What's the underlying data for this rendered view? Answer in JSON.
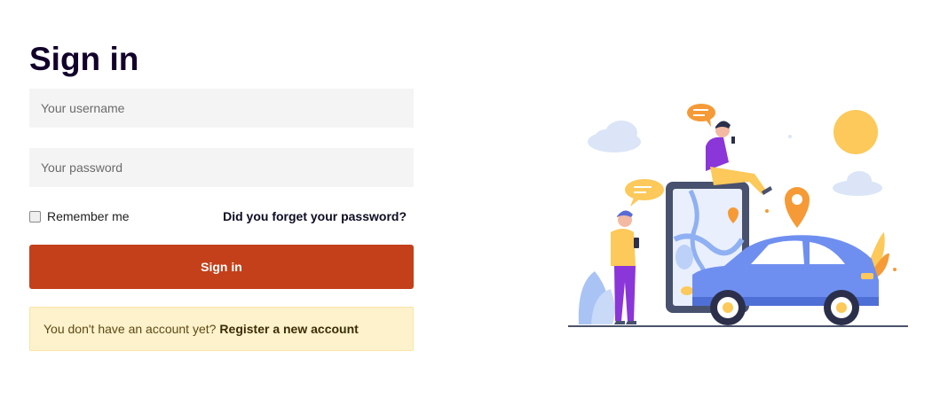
{
  "form": {
    "title": "Sign in",
    "username_placeholder": "Your username",
    "password_placeholder": "Your password",
    "remember_label": "Remember me",
    "remember_checked": false,
    "forgot_link": "Did you forget your password?",
    "submit_label": "Sign in",
    "notice_text": "You don't have an account yet?",
    "register_link": "Register a new account"
  },
  "illustration": {
    "subject": "car-navigation-illustration"
  },
  "colors": {
    "primary_button": "#c4401a",
    "notice_background": "#fef2cc",
    "title": "#12002b"
  }
}
